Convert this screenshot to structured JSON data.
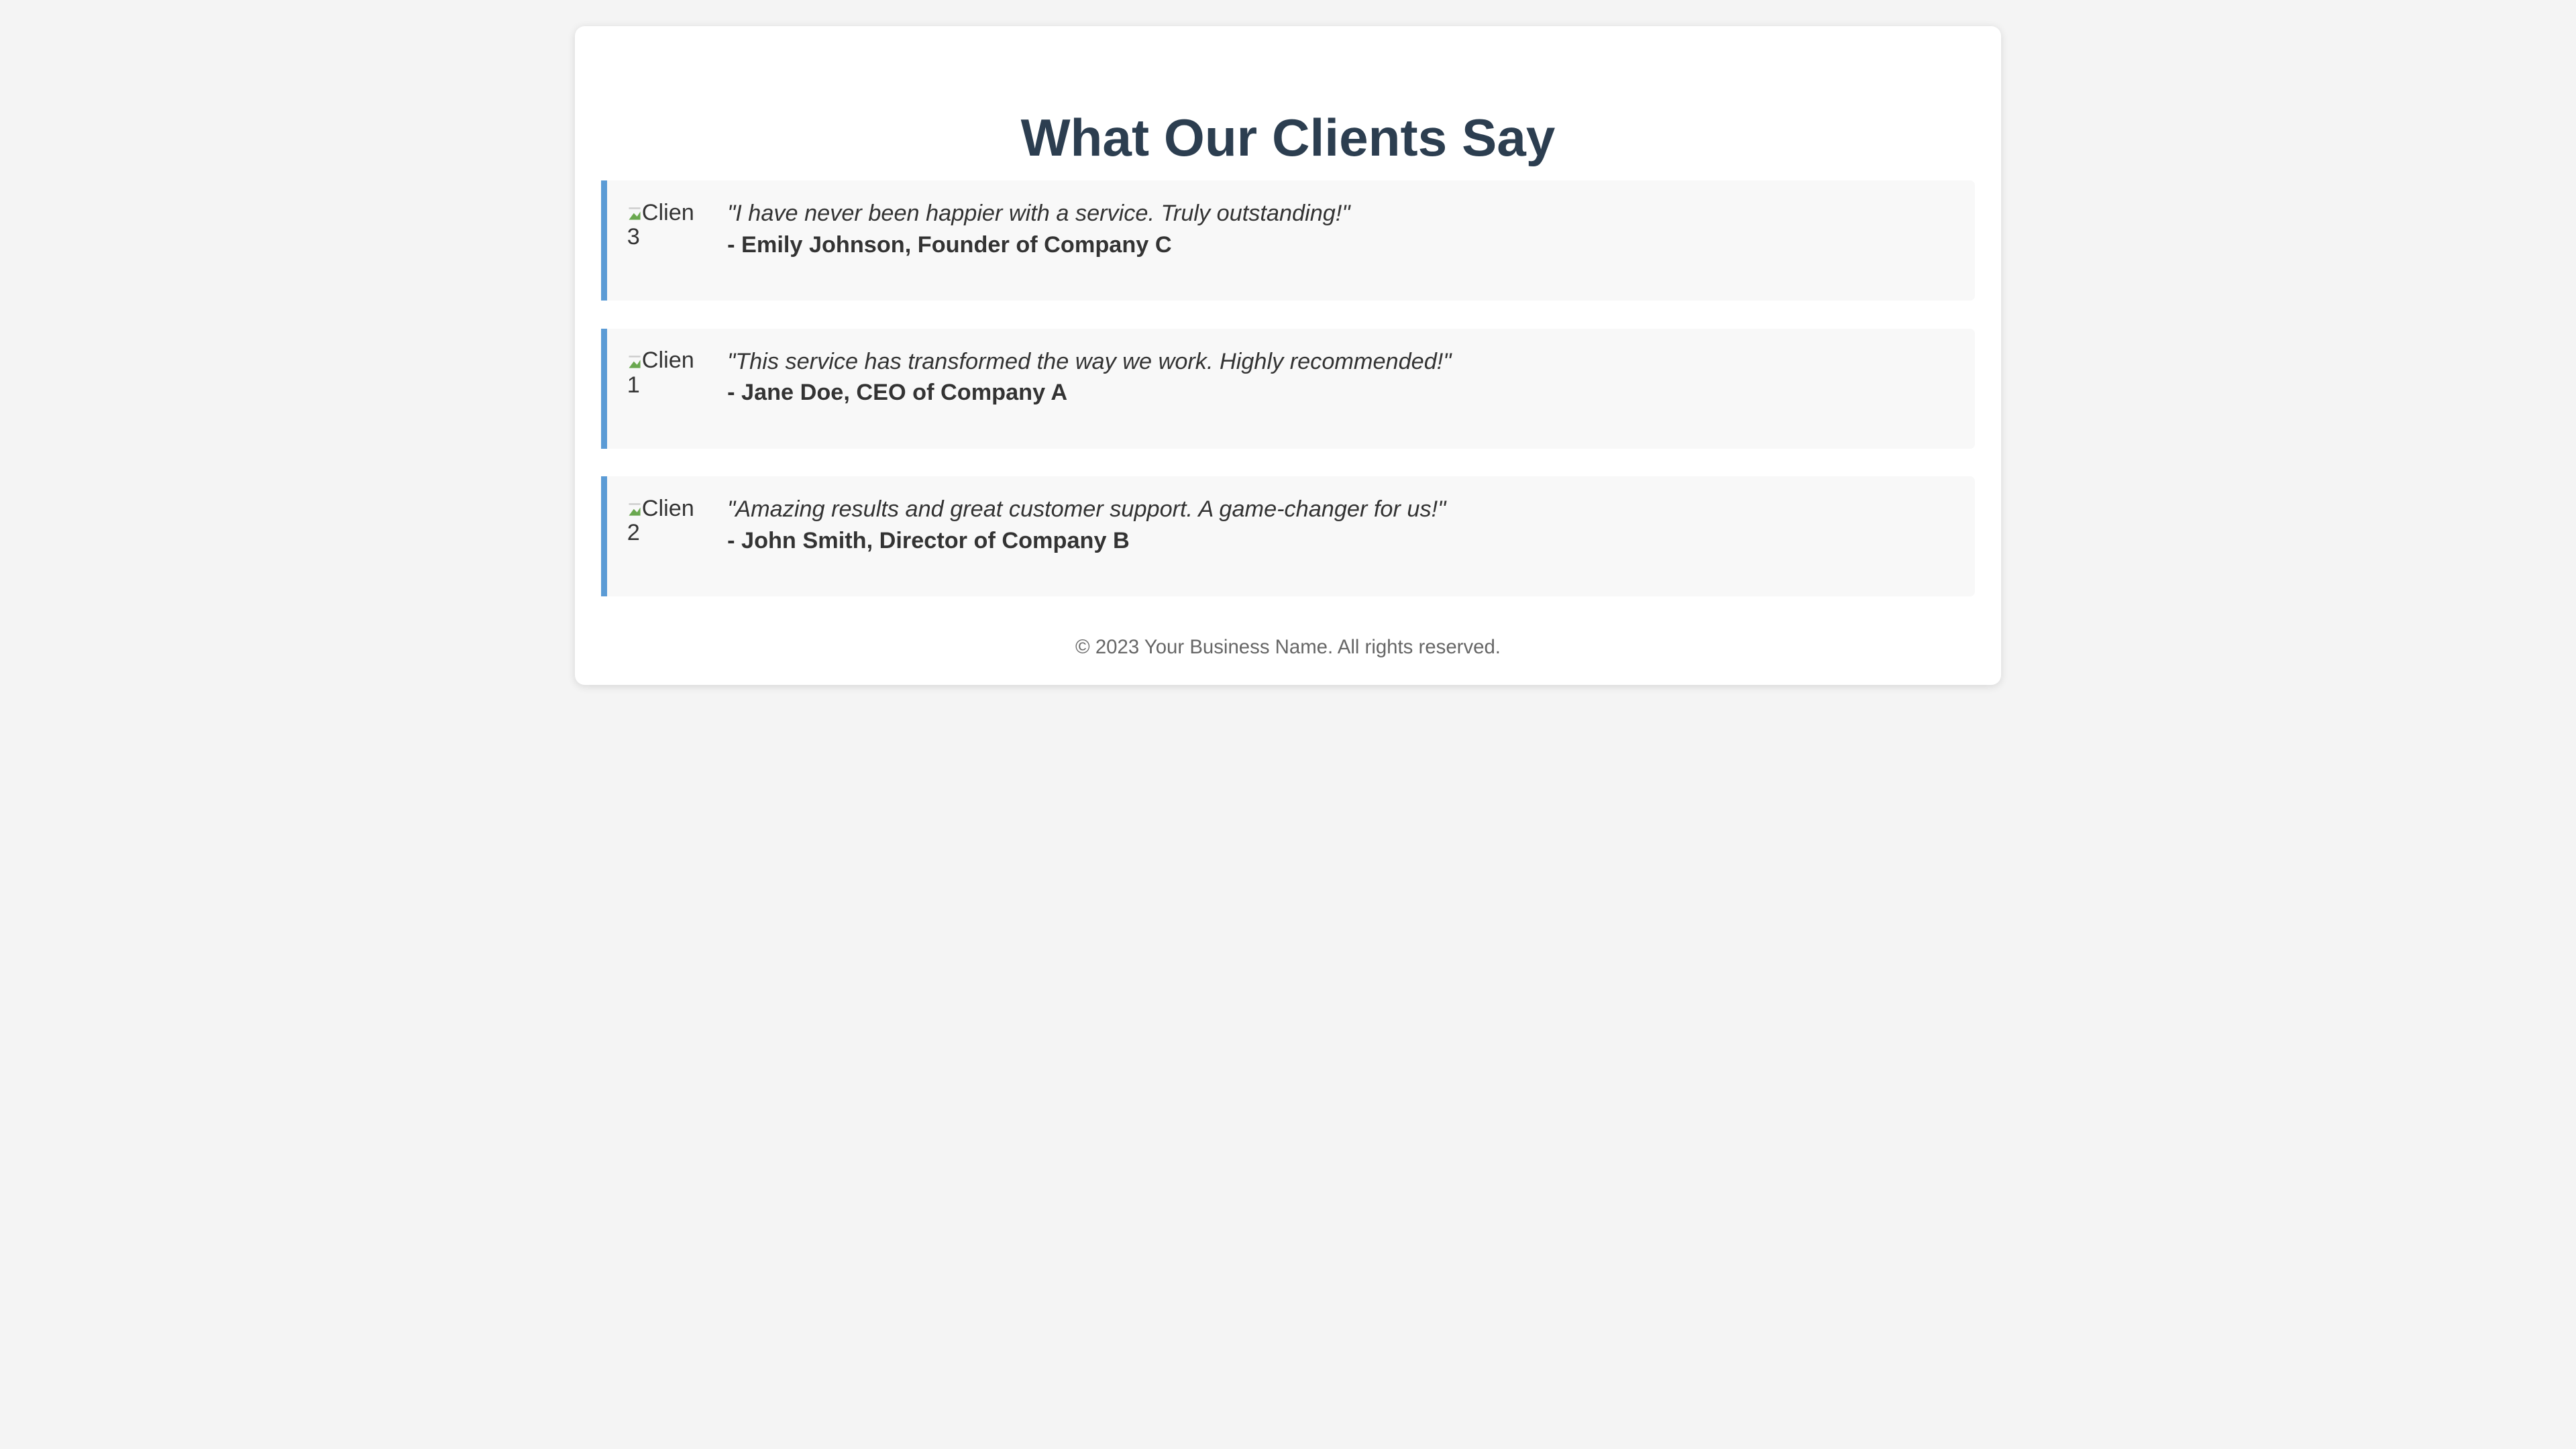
{
  "page": {
    "title": "What Our Clients Say"
  },
  "testimonials": [
    {
      "avatar_alt_line1": "Clien",
      "avatar_alt_line2": "3",
      "quote": "\"I have never been happier with a service. Truly outstanding!\"",
      "author": "- Emily Johnson, Founder of Company C"
    },
    {
      "avatar_alt_line1": "Clien",
      "avatar_alt_line2": "1",
      "quote": "\"This service has transformed the way we work. Highly recommended!\"",
      "author": "- Jane Doe, CEO of Company A"
    },
    {
      "avatar_alt_line1": "Clien",
      "avatar_alt_line2": "2",
      "quote": "\"Amazing results and great customer support. A game-changer for us!\"",
      "author": "- John Smith, Director of Company B"
    }
  ],
  "footer": {
    "text": "© 2023 Your Business Name. All rights reserved."
  },
  "colors": {
    "background": "#f4f4f4",
    "card_background": "#f8f8f8",
    "accent": "#5b9bd5",
    "title": "#2c3e50",
    "text": "#333333",
    "muted": "#666666"
  },
  "icons": {
    "avatar": "broken-image-icon"
  }
}
